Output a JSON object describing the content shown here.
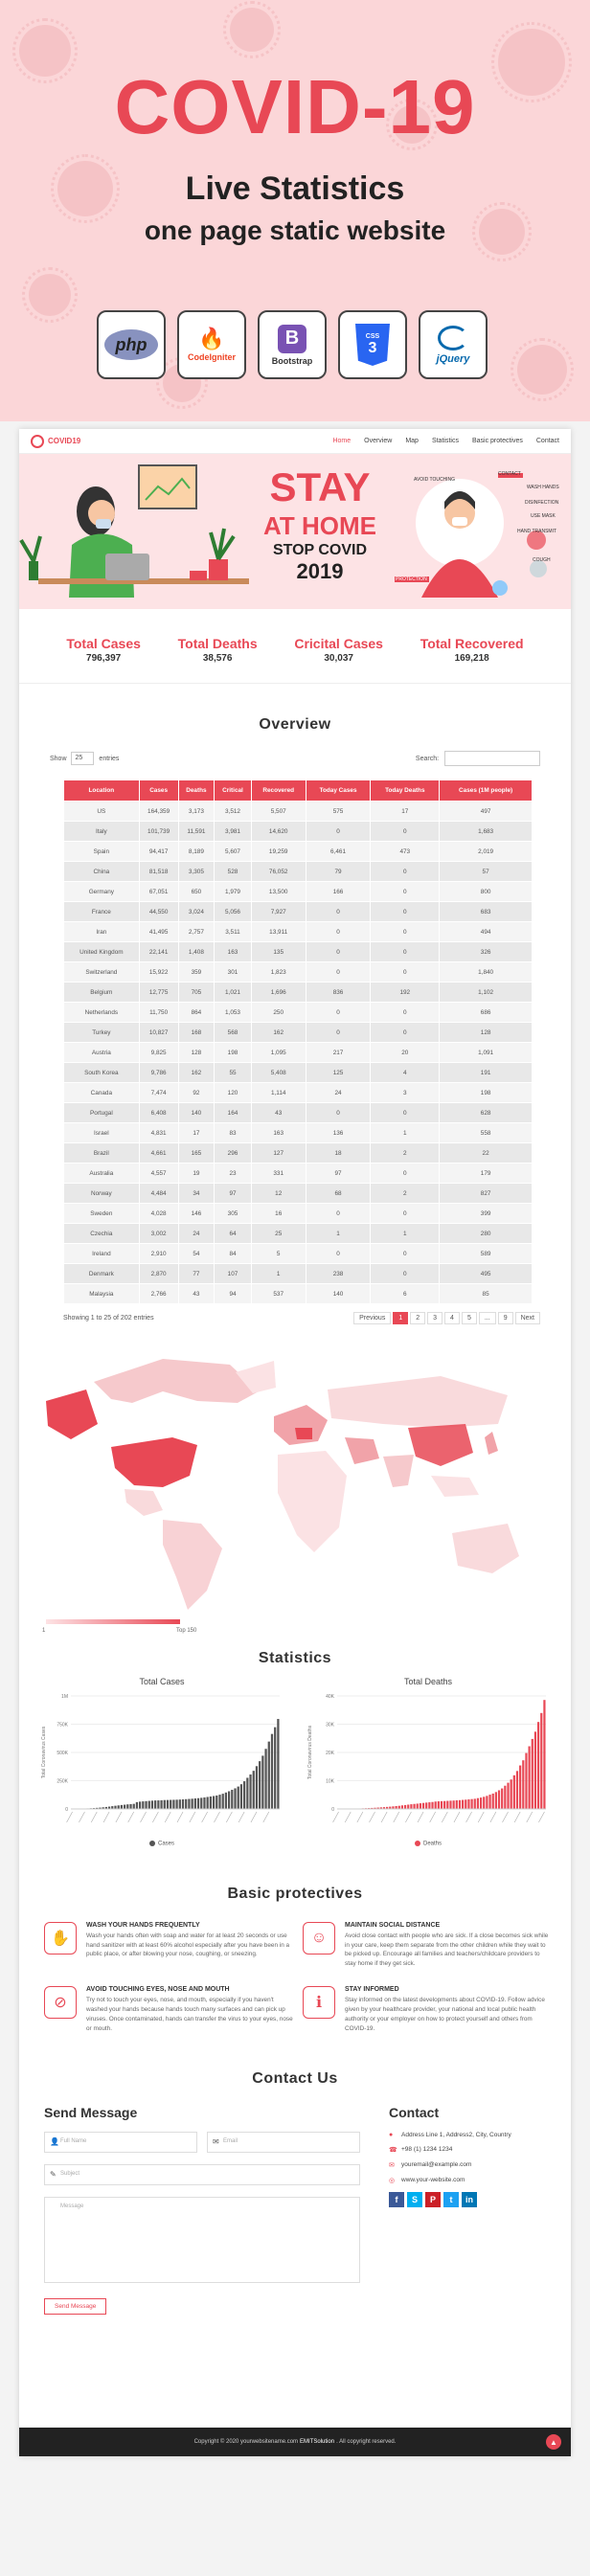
{
  "promo": {
    "title": "COVID-19",
    "subtitle1": "Live Statistics",
    "subtitle2": "one page static website",
    "techs": [
      {
        "name": "php",
        "label": "",
        "color": "#777bb3",
        "icon": "php-icon"
      },
      {
        "name": "",
        "label": "CodeIgniter",
        "color": "#ee4323",
        "icon": "codeigniter-icon"
      },
      {
        "name": "B",
        "label": "Bootstrap",
        "color": "#7952b3",
        "icon": "bootstrap-icon"
      },
      {
        "name": "CSS",
        "label": "",
        "color": "#2965f1",
        "icon": "css3-icon"
      },
      {
        "name": "",
        "label": "jQuery",
        "color": "#0769ad",
        "icon": "jquery-icon"
      }
    ]
  },
  "nav": {
    "brand": "COVID19",
    "links": [
      "Home",
      "Overview",
      "Map",
      "Statistics",
      "Basic protectives",
      "Contact"
    ]
  },
  "hero": {
    "stay": "STAY",
    "at_home": "AT HOME",
    "stop_covid": "STOP COVID",
    "year": "2019",
    "labels": [
      "CONTACT",
      "WASH HANDS",
      "DISINFECTION",
      "USE MASK",
      "AVOID TOUCHING",
      "HAND TRANSMIT",
      "PROTECTION",
      "COUGH"
    ]
  },
  "totals": [
    {
      "label": "Total Cases",
      "value": "796,397"
    },
    {
      "label": "Total Deaths",
      "value": "38,576"
    },
    {
      "label": "Cricital Cases",
      "value": "30,037"
    },
    {
      "label": "Total Recovered",
      "value": "169,218"
    }
  ],
  "overview": {
    "title": "Overview",
    "show": "Show",
    "entries_value": "25",
    "entries": "entries",
    "search": "Search:",
    "columns": [
      "Location",
      "Cases",
      "Deaths",
      "Critical",
      "Recovered",
      "Today Cases",
      "Today Deaths",
      "Cases (1M people)"
    ],
    "rows": [
      [
        "US",
        "164,359",
        "3,173",
        "3,512",
        "5,507",
        "575",
        "17",
        "497"
      ],
      [
        "Italy",
        "101,739",
        "11,591",
        "3,981",
        "14,620",
        "0",
        "0",
        "1,683"
      ],
      [
        "Spain",
        "94,417",
        "8,189",
        "5,607",
        "19,259",
        "6,461",
        "473",
        "2,019"
      ],
      [
        "China",
        "81,518",
        "3,305",
        "528",
        "76,052",
        "79",
        "0",
        "57"
      ],
      [
        "Germany",
        "67,051",
        "650",
        "1,979",
        "13,500",
        "166",
        "0",
        "800"
      ],
      [
        "France",
        "44,550",
        "3,024",
        "5,056",
        "7,927",
        "0",
        "0",
        "683"
      ],
      [
        "Iran",
        "41,495",
        "2,757",
        "3,511",
        "13,911",
        "0",
        "0",
        "494"
      ],
      [
        "United Kingdom",
        "22,141",
        "1,408",
        "163",
        "135",
        "0",
        "0",
        "326"
      ],
      [
        "Switzerland",
        "15,922",
        "359",
        "301",
        "1,823",
        "0",
        "0",
        "1,840"
      ],
      [
        "Belgium",
        "12,775",
        "705",
        "1,021",
        "1,696",
        "836",
        "192",
        "1,102"
      ],
      [
        "Netherlands",
        "11,750",
        "864",
        "1,053",
        "250",
        "0",
        "0",
        "686"
      ],
      [
        "Turkey",
        "10,827",
        "168",
        "568",
        "162",
        "0",
        "0",
        "128"
      ],
      [
        "Austria",
        "9,825",
        "128",
        "198",
        "1,095",
        "217",
        "20",
        "1,091"
      ],
      [
        "South Korea",
        "9,786",
        "162",
        "55",
        "5,408",
        "125",
        "4",
        "191"
      ],
      [
        "Canada",
        "7,474",
        "92",
        "120",
        "1,114",
        "24",
        "3",
        "198"
      ],
      [
        "Portugal",
        "6,408",
        "140",
        "164",
        "43",
        "0",
        "0",
        "628"
      ],
      [
        "Israel",
        "4,831",
        "17",
        "83",
        "163",
        "136",
        "1",
        "558"
      ],
      [
        "Brazil",
        "4,661",
        "165",
        "296",
        "127",
        "18",
        "2",
        "22"
      ],
      [
        "Australia",
        "4,557",
        "19",
        "23",
        "331",
        "97",
        "0",
        "179"
      ],
      [
        "Norway",
        "4,484",
        "34",
        "97",
        "12",
        "68",
        "2",
        "827"
      ],
      [
        "Sweden",
        "4,028",
        "146",
        "305",
        "16",
        "0",
        "0",
        "399"
      ],
      [
        "Czechia",
        "3,002",
        "24",
        "64",
        "25",
        "1",
        "1",
        "280"
      ],
      [
        "Ireland",
        "2,910",
        "54",
        "84",
        "5",
        "0",
        "0",
        "589"
      ],
      [
        "Denmark",
        "2,870",
        "77",
        "107",
        "1",
        "238",
        "0",
        "495"
      ],
      [
        "Malaysia",
        "2,766",
        "43",
        "94",
        "537",
        "140",
        "6",
        "85"
      ]
    ],
    "showing": "Showing 1 to 25 of 202 entries",
    "pages": [
      "Previous",
      "1",
      "2",
      "3",
      "4",
      "5",
      "...",
      "9",
      "Next"
    ]
  },
  "map": {
    "legend_min": "1",
    "legend_max": "Top 150"
  },
  "statistics": {
    "title": "Statistics"
  },
  "chart_data": [
    {
      "type": "bar",
      "title": "Total Cases",
      "ylabel": "Total Coronavirus Cases",
      "ylim": [
        0,
        1000000
      ],
      "yticks": [
        "0",
        "250K",
        "500K",
        "750K",
        "1M"
      ],
      "series": [
        {
          "name": "Cases",
          "color": "#555555",
          "values": [
            580,
            845,
            1317,
            2015,
            2800,
            4581,
            6058,
            7813,
            9823,
            11950,
            14553,
            17391,
            20630,
            24554,
            28276,
            31481,
            34886,
            37558,
            40554,
            43103,
            45171,
            60374,
            64617,
            67100,
            69197,
            71329,
            73332,
            75184,
            75700,
            76677,
            78651,
            79205,
            80087,
            80828,
            81820,
            83112,
            84615,
            86604,
            88585,
            90443,
            93016,
            95314,
            98425,
            102050,
            106099,
            109991,
            114381,
            118948,
            126214,
            134576,
            145483,
            156653,
            169593,
            182490,
            198238,
            218822,
            244933,
            275597,
            305036,
            337489,
            378830,
            422574,
            471035,
            531865,
            596366,
            663740,
            723319,
            796397
          ]
        }
      ]
    },
    {
      "type": "bar",
      "title": "Total Deaths",
      "ylabel": "Total Coronavirus Deaths",
      "ylim": [
        0,
        40000
      ],
      "yticks": [
        "0",
        "10K",
        "20K",
        "30K",
        "40K"
      ],
      "series": [
        {
          "name": "Deaths",
          "color": "#e84855",
          "values": [
            17,
            25,
            41,
            56,
            80,
            106,
            132,
            170,
            213,
            259,
            304,
            362,
            426,
            492,
            565,
            638,
            724,
            813,
            910,
            1018,
            1115,
            1261,
            1383,
            1526,
            1669,
            1775,
            1873,
            2009,
            2126,
            2247,
            2360,
            2460,
            2618,
            2699,
            2763,
            2800,
            2858,
            2923,
            2977,
            3050,
            3117,
            3202,
            3285,
            3387,
            3494,
            3599,
            3827,
            4025,
            4296,
            4628,
            5060,
            5439,
            5982,
            6616,
            7266,
            8228,
            9283,
            10424,
            11909,
            13439,
            15405,
            17218,
            19803,
            22193,
            24777,
            27346,
            30788,
            33961,
            38576
          ]
        }
      ]
    }
  ],
  "protectives": {
    "title": "Basic protectives",
    "items": [
      {
        "heading": "WASH YOUR HANDS FREQUENTLY",
        "text": "Wash your hands often with soap and water for at least 20 seconds or use hand sanitizer with at least 60% alcohol especially after you have been in a public place, or after blowing your nose, coughing, or sneezing.",
        "icon": "hand-wash-icon"
      },
      {
        "heading": "MAINTAIN SOCIAL DISTANCE",
        "text": "Avoid close contact with people who are sick. If a close becomes sick while in your care, keep them separate from the other children while they wait to be picked up. Encourage all families and teachers/childcare providers to stay home if they get sick.",
        "icon": "social-distance-icon"
      },
      {
        "heading": "AVOID TOUCHING EYES, NOSE AND MOUTH",
        "text": "Try not to touch your eyes, nose, and mouth, especially if you haven't washed your hands because hands touch many surfaces and can pick up viruses. Once contaminated, hands can transfer the virus to your eyes, nose or mouth.",
        "icon": "no-touch-face-icon"
      },
      {
        "heading": "STAY INFORMED",
        "text": "Stay informed on the latest developments about COVID-19. Follow advice given by your healthcare provider, your national and local public health authority or your employer on how to protect yourself and others from COVID-19.",
        "icon": "info-icon"
      }
    ]
  },
  "contact": {
    "title": "Contact Us",
    "send_title": "Send Message",
    "name_placeholder": "Full Name",
    "email_placeholder": "Email",
    "subject_placeholder": "Subject",
    "message_placeholder": "Message",
    "send_button": "Send Message",
    "info_title": "Contact",
    "address": "Address Line 1, Address2, City, Country",
    "phone": "+98 (1) 1234 1234",
    "email": "youremail@example.com",
    "website": "www.your-website.com",
    "socials": [
      {
        "name": "f",
        "color": "#3b5998"
      },
      {
        "name": "S",
        "color": "#00aff0"
      },
      {
        "name": "P",
        "color": "#cb2027"
      },
      {
        "name": "t",
        "color": "#1da1f2"
      },
      {
        "name": "in",
        "color": "#0077b5"
      }
    ]
  },
  "footer": {
    "pre": "Copyright © 2020 yourwebsitename.com",
    "brand": "EMITSolution",
    "post": ". All copyright reserved."
  }
}
